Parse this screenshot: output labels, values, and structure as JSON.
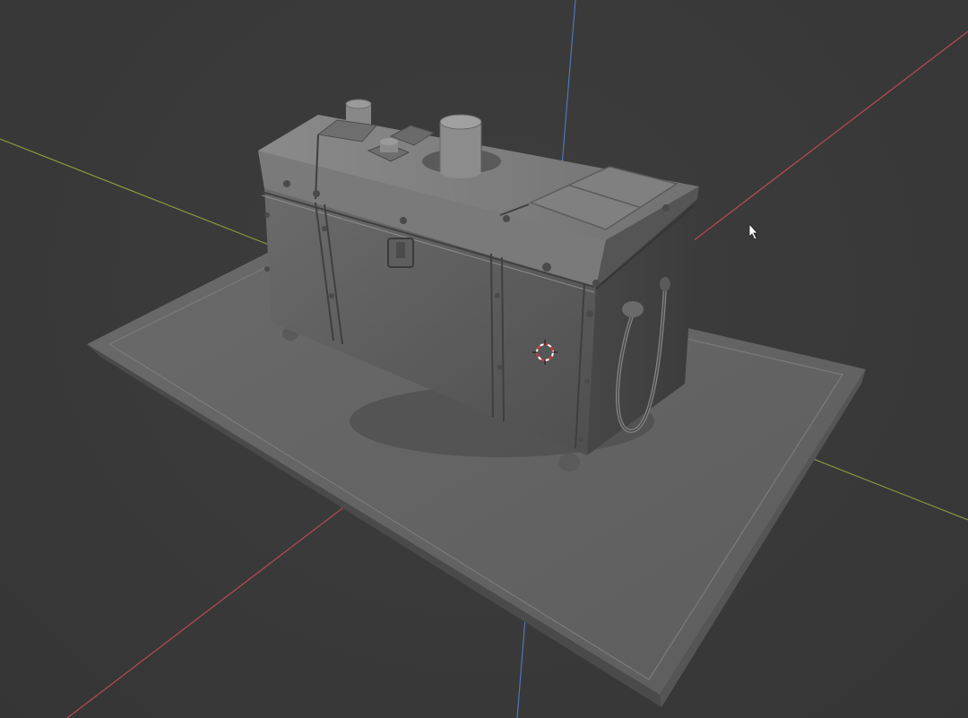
{
  "app": {
    "mode": "3D viewport",
    "shading": "solid"
  },
  "viewport": {
    "background_color": "#3a3a3a",
    "axis_colors": {
      "x_axis": "#b84a56",
      "y_axis": "#8aa03c",
      "z_axis": "#4f76b8"
    },
    "cursor_icon": "mouse-pointer-icon",
    "cursor_3d_icon": "3d-cursor-icon"
  },
  "scene": {
    "objects": [
      "ground-plane",
      "treasure-chest"
    ]
  }
}
